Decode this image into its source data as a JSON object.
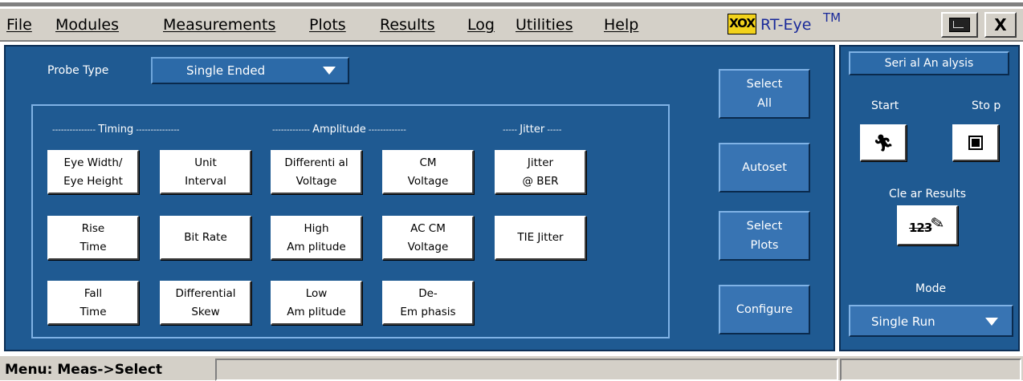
{
  "menubar": {
    "items": [
      {
        "label": "File"
      },
      {
        "label": "Modules"
      },
      {
        "label": "Measurements"
      },
      {
        "label": "Plots"
      },
      {
        "label": "Results"
      },
      {
        "label": "Log"
      },
      {
        "label": "Utilities"
      },
      {
        "label": "Help"
      }
    ],
    "logo_text": "XOX",
    "app_title": "RT-Eye",
    "trademark": "TM",
    "close_label": "X"
  },
  "probe": {
    "label": "Probe Type",
    "value": "Single Ended"
  },
  "sections": {
    "timing": "Timing",
    "amplitude": "Amplitude",
    "jitter": "Jitter"
  },
  "measurements": [
    {
      "label": "Eye Width/\nEye Height"
    },
    {
      "label": "Unit\nInterval"
    },
    {
      "label": "Differenti al\nVoltage"
    },
    {
      "label": "CM\nVoltage"
    },
    {
      "label": "Jitter\n@ BER"
    },
    {
      "label": "Rise\nTime"
    },
    {
      "label": "Bit Rate"
    },
    {
      "label": "High\nAm plitude"
    },
    {
      "label": "AC CM\nVoltage"
    },
    {
      "label": "TIE Jitter"
    },
    {
      "label": "Fall\nTime"
    },
    {
      "label": "Differential\nSkew"
    },
    {
      "label": "Low\nAm plitude"
    },
    {
      "label": "De-\nEm phasis"
    }
  ],
  "side_buttons": {
    "select_all": "Select\nAll",
    "autoset": "Autoset",
    "select_plots": "Select\nPlots",
    "configure": "Configure"
  },
  "right_panel": {
    "serial_analysis": "Seri al An alysis",
    "start": "Start",
    "stop": "Sto p",
    "clear_results": "Cle ar Results",
    "clear_icon_text": "123",
    "mode_label": "Mode",
    "mode_value": "Single Run"
  },
  "status": {
    "text": "Menu: Meas->Select"
  },
  "colors": {
    "panel_bg": "#1f5a92",
    "button_bg": "#3874b3",
    "chrome": "#d4d0c8",
    "logo": "#f2d21b"
  }
}
